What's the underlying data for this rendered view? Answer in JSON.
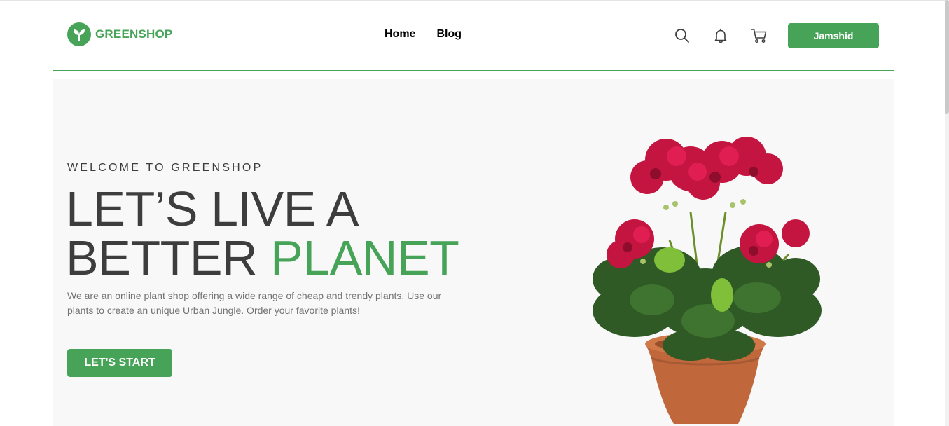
{
  "header": {
    "brand": "GREENSHOP",
    "nav": [
      {
        "label": "Home"
      },
      {
        "label": "Blog"
      }
    ],
    "icons": [
      "search-icon",
      "bell-icon",
      "cart-icon"
    ],
    "user_button_label": "Jamshid"
  },
  "hero": {
    "eyebrow": "WELCOME TO GREENSHOP",
    "headline_line1": "LET’S LIVE A",
    "headline_line2_plain": "BETTER ",
    "headline_line2_accent": "PLANET",
    "description": "We are an online plant shop offering a wide range of cheap and trendy plants. Use our plants to create an unique Urban Jungle. Order your favorite plants!",
    "cta_label": "LET'S START",
    "image": "potted-red-geranium"
  },
  "colors": {
    "brand": "#46a358",
    "text": "#3d3d3d",
    "muted": "#727272",
    "hero_bg": "#f8f8f8"
  }
}
